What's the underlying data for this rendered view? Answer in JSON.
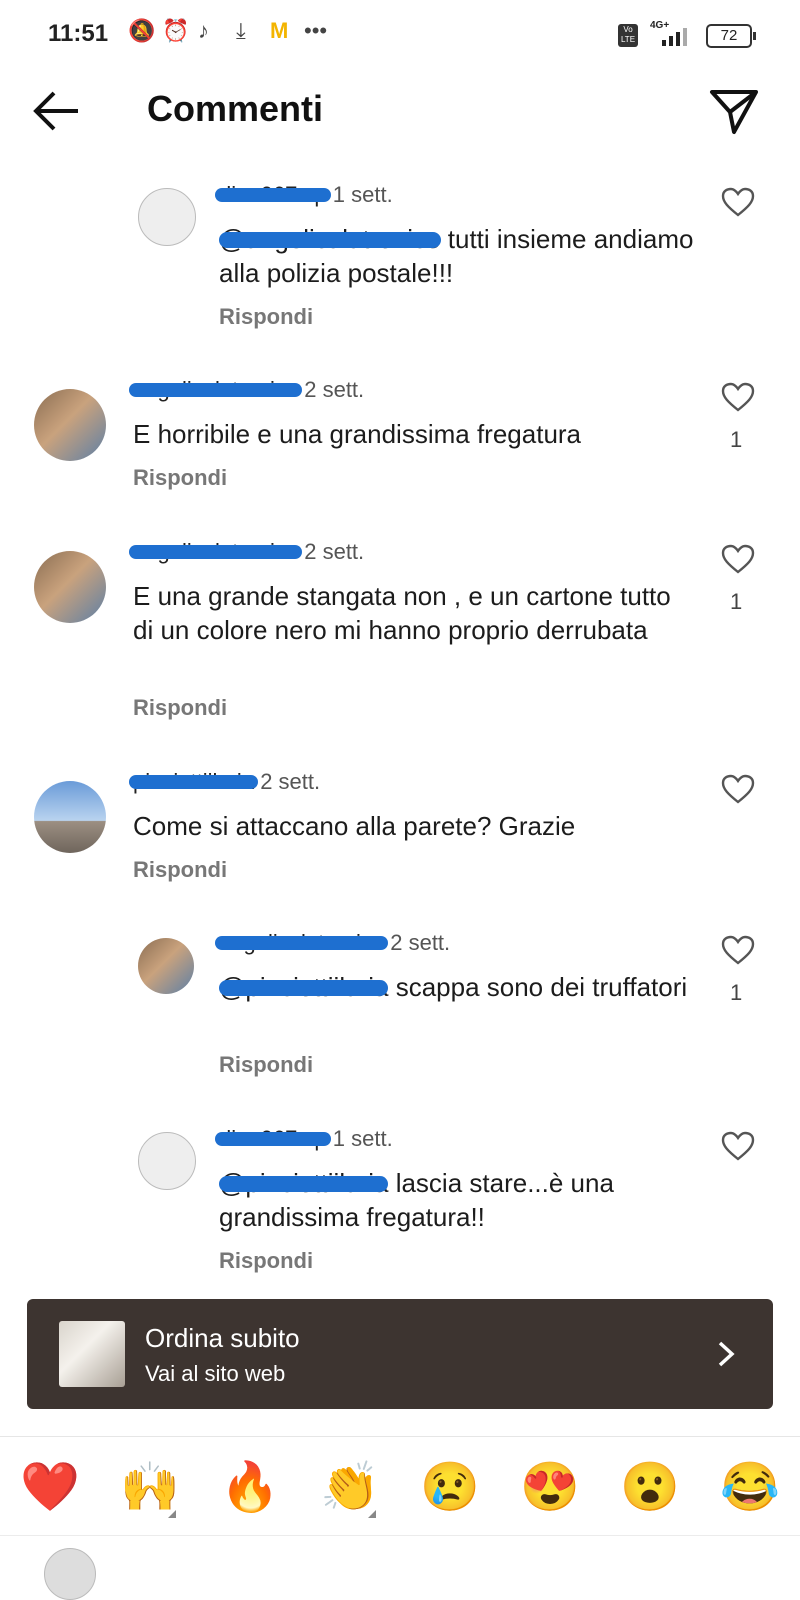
{
  "status_bar": {
    "time": "11:51",
    "battery": "72",
    "network": "4G+",
    "lte": "Vo LTE"
  },
  "header": {
    "title": "Commenti"
  },
  "comments": [
    {
      "user": "dino067.sp",
      "age": "1 sett.",
      "mention": "@angelicalatronico",
      "text": " tutti insieme andiamo alla polizia postale!!!",
      "reply": "Rispondi",
      "likes": ""
    },
    {
      "user": "angelicalatronico",
      "age": "2 sett.",
      "mention": "",
      "text": "E horribile e una grandissima fregatura",
      "reply": "Rispondi",
      "likes": "1"
    },
    {
      "user": "angelicalatronico",
      "age": "2 sett.",
      "mention": "",
      "text": "E una grande stangata non , e un cartone tutto di un colore nero mi hanno proprio derrubata",
      "reply": "Rispondi",
      "likes": "1"
    },
    {
      "user": "pinciottiilaria",
      "age": "2 sett.",
      "mention": "",
      "text": "Come si attaccano alla parete? Grazie",
      "reply": "Rispondi",
      "likes": ""
    },
    {
      "user": "angelicalatronico",
      "age": "2 sett.",
      "mention": "@pinciottiilaria",
      "text": " scappa sono dei truffatori",
      "reply": "Rispondi",
      "likes": "1"
    },
    {
      "user": "dino067.sp",
      "age": "1 sett.",
      "mention": "@pinciottiilaria",
      "text": " lascia stare...è una grandissima fregatura!!",
      "reply": "Rispondi",
      "likes": ""
    }
  ],
  "ad": {
    "title": "Ordina subito",
    "subtitle": "Vai al sito web"
  },
  "emojis": [
    "❤️",
    "🙌",
    "🔥",
    "👏",
    "😢",
    "😍",
    "😮",
    "😂"
  ],
  "colors": {
    "ad_background": "#3d3430",
    "redaction": "#1e6fd0"
  }
}
